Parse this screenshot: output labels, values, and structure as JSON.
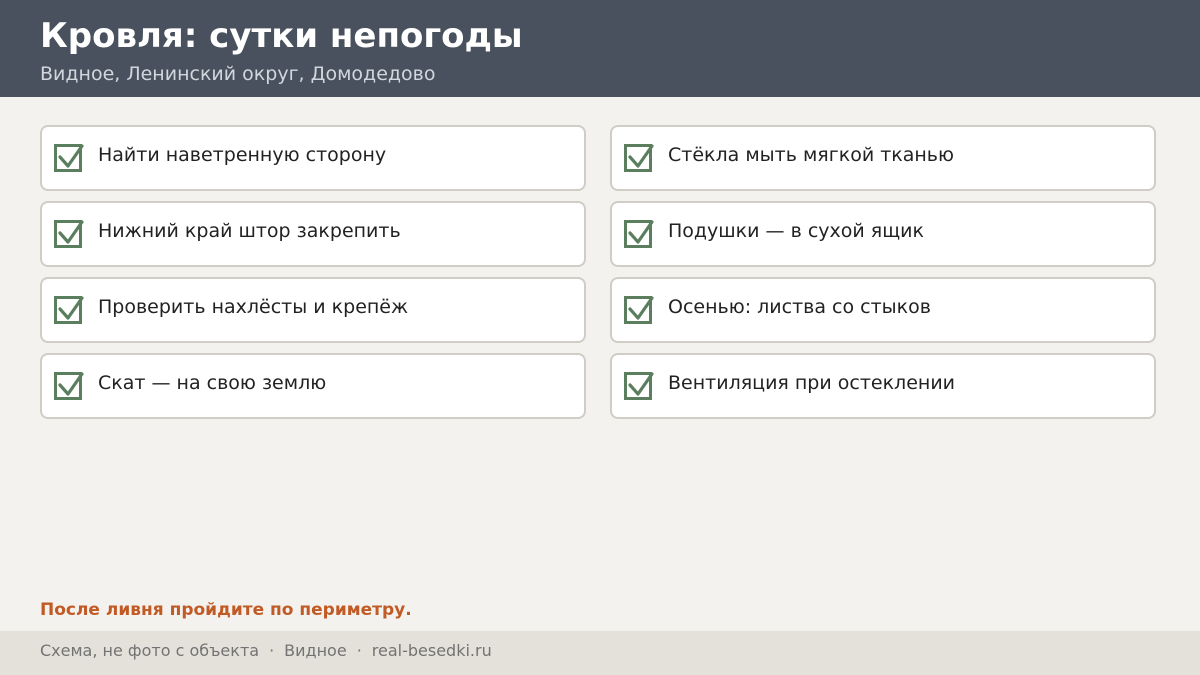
{
  "header": {
    "title": "Кровля: сутки непогоды",
    "subtitle": "Видное, Ленинский округ, Домодедово"
  },
  "checklist": [
    {
      "label": "Найти наветренную сторону",
      "checked": true
    },
    {
      "label": "Стёкла мыть мягкой тканью",
      "checked": true
    },
    {
      "label": "Нижний край штор закрепить",
      "checked": true
    },
    {
      "label": "Подушки — в сухой ящик",
      "checked": true
    },
    {
      "label": "Проверить нахлёсты и крепёж",
      "checked": true
    },
    {
      "label": "Осенью: листва со стыков",
      "checked": true
    },
    {
      "label": "Скат — на свою землю",
      "checked": true
    },
    {
      "label": "Вентиляция при остеклении",
      "checked": true
    }
  ],
  "note": "После ливня пройдите по периметру.",
  "footer": {
    "caption": "Схема, не фото с объекта",
    "separator": "·",
    "city": "Видное",
    "site": "real-besedki.ru"
  },
  "colors": {
    "header_bg": "#48515d",
    "accent": "#c15a24",
    "check_green": "#5b7e5f",
    "page_bg": "#f3f2ee",
    "footer_bg": "#e4e1da"
  },
  "icons": {
    "checkbox": "checkbox-checked-icon"
  }
}
